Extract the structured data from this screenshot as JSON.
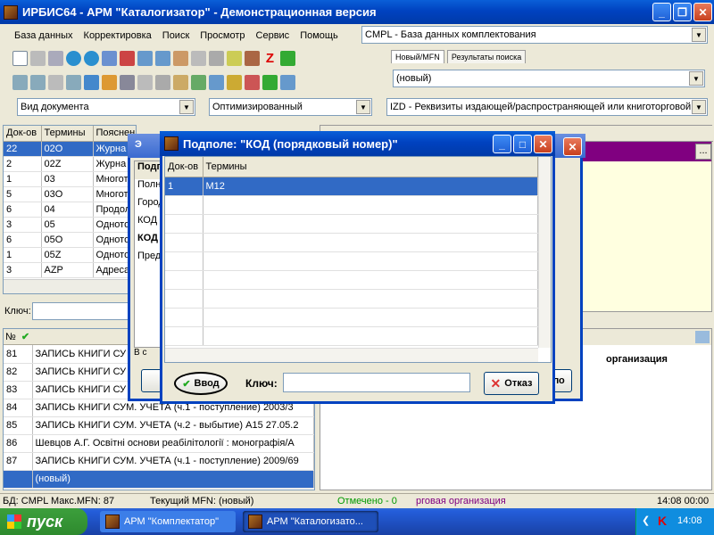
{
  "window": {
    "title": "ИРБИС64 - АРМ \"Каталогизатор\" - Демонстрационная версия"
  },
  "menu": [
    "База данных",
    "Корректировка",
    "Поиск",
    "Просмотр",
    "Сервис",
    "Помощь"
  ],
  "db_combo": "CMPL - База данных комплектования",
  "tabs": {
    "new": "Новый/MFN",
    "results": "Результаты поиска"
  },
  "new_combo": "(новый)",
  "doc_view_combo": "Вид документа",
  "optimized_combo": "Оптимизированный",
  "field_combo": "IZD - Реквизиты издающей/распространяющей или книготорговой",
  "dict": {
    "headers": [
      "Док-ов",
      "Термины",
      "Пояснен"
    ],
    "rows": [
      [
        "22",
        "02O",
        "Журна"
      ],
      [
        "2",
        "02Z",
        "Журна"
      ],
      [
        "1",
        "03",
        "Многото"
      ],
      [
        "5",
        "03O",
        "Многото"
      ],
      [
        "6",
        "04",
        "Продол"
      ],
      [
        "3",
        "05",
        "Одното"
      ],
      [
        "6",
        "05O",
        "Одното"
      ],
      [
        "1",
        "05Z",
        "Одното"
      ],
      [
        "3",
        "AZP",
        "Адреса"
      ]
    ],
    "key_label": "Ключ:"
  },
  "records": {
    "header_num": "№",
    "rows": [
      [
        "81",
        "ЗАПИСЬ КНИГИ СУ"
      ],
      [
        "82",
        "ЗАПИСЬ КНИГИ СУ"
      ],
      [
        "83",
        "ЗАПИСЬ КНИГИ СУ"
      ],
      [
        "84",
        "ЗАПИСЬ КНИГИ СУМ. УЧЕТА (ч.1 - поступление)  2003/3"
      ],
      [
        "85",
        "ЗАПИСЬ КНИГИ СУМ. УЧЕТА (ч.2 - выбытие)  А15 27.05.2"
      ],
      [
        "86",
        "Шевцов А.Г. Освітні основи реабілітології : монографія/А"
      ],
      [
        "87",
        "ЗАПИСЬ КНИГИ СУМ. УЧЕТА (ч.1 - поступление)  2009/69"
      ],
      [
        "",
        "(новый)"
      ]
    ]
  },
  "right_panel": {
    "text": "организация",
    "b_text": "В с"
  },
  "bg_dialog": {
    "title": "Э",
    "rows": [
      "Подпо",
      "Полно",
      "Город",
      "КОД (",
      "КОД (",
      "Предс"
    ],
    "ok_label": "",
    "side_text": "ло"
  },
  "dialog": {
    "title": "Подполе: \"КОД (порядковый номер)\"",
    "headers": [
      "Док-ов",
      "Термины"
    ],
    "rows": [
      [
        "1",
        "M12"
      ]
    ],
    "ok_label": "Ввод",
    "key_label": "Ключ:",
    "key_value": "",
    "cancel_label": "Отказ"
  },
  "status": {
    "db": "БД: CMPL Макс.MFN: 87",
    "mfn": "Текущий MFN: (новый)",
    "marked": "Отмечено - 0",
    "org": "рговая организация",
    "time": "14:08  00:00"
  },
  "taskbar": {
    "start": "пуск",
    "task1": "АРМ \"Комплектатор\"",
    "task2": "АРМ \"Каталогизато...",
    "clock": "14:08"
  },
  "colors": {
    "purple": "#800080",
    "selection": "#316ac5",
    "accent": "#0042c0"
  }
}
